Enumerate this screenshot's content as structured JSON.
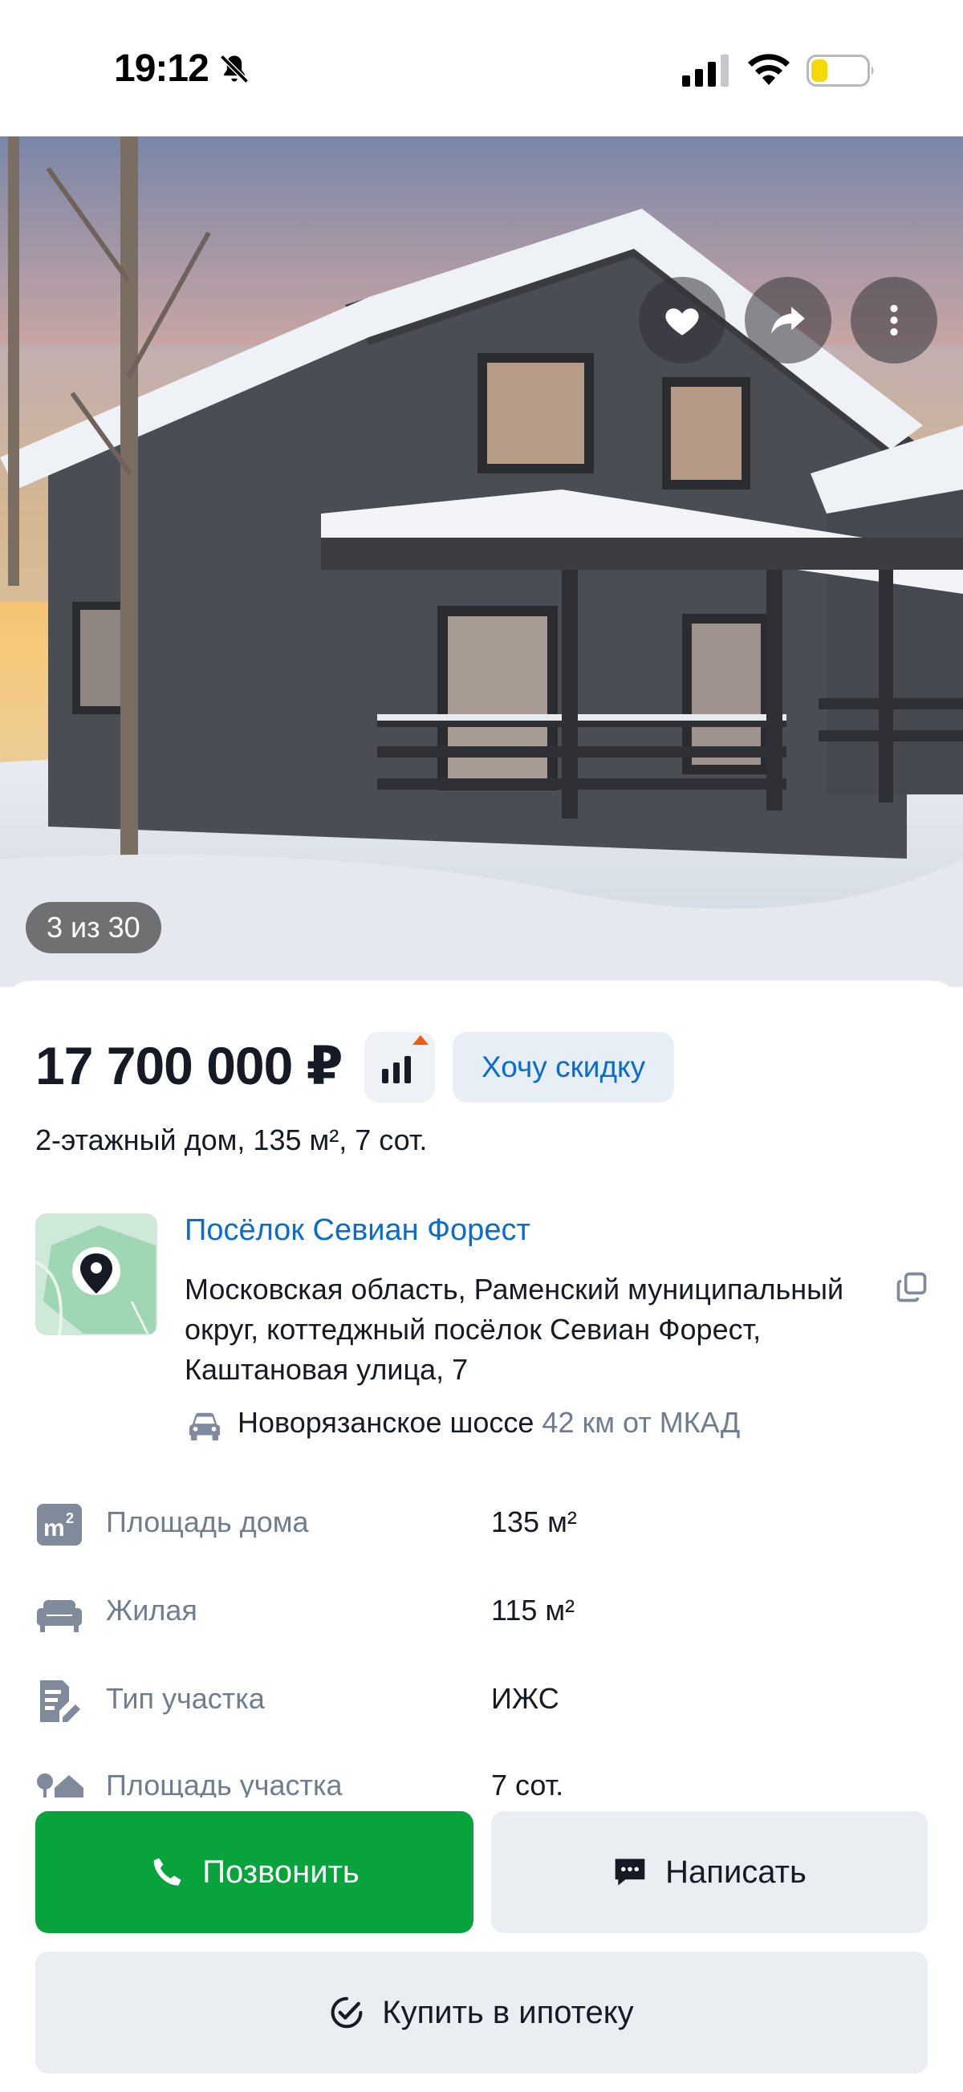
{
  "status_bar": {
    "time": "19:12"
  },
  "photo": {
    "counter": "3 из 30",
    "favorite_icon": "heart-icon",
    "share_icon": "share-arrow-icon",
    "more_icon": "more-vertical-icon"
  },
  "listing": {
    "price": "17 700 000 ₽",
    "discount_button": "Хочу скидку",
    "subtitle": "2-этажный дом, 135 м², 7 сот.",
    "village_link": "Посёлок Севиан Форест",
    "address": "Московская область, Раменский муниципальный округ, коттеджный посёлок Севиан Форест, Каштановая улица, 7",
    "highway": "Новорязанское шоссе",
    "distance": "42 км от МКАД"
  },
  "properties": [
    {
      "icon": "area-m2-icon",
      "label": "Площадь дома",
      "value": "135 м²"
    },
    {
      "icon": "sofa-icon",
      "label": "Жилая",
      "value": "115 м²"
    },
    {
      "icon": "document-pen-icon",
      "label": "Тип участка",
      "value": "ИЖС"
    },
    {
      "icon": "trees-house-icon",
      "label": "Площадь участка",
      "value": "7 сот."
    }
  ],
  "actions": {
    "call": "Позвонить",
    "write": "Написать",
    "mortgage": "Купить в ипотеку"
  },
  "colors": {
    "accent_blue": "#0a6ccf",
    "call_green": "#09a33e",
    "price_up_orange": "#f05a12",
    "muted_text": "#6f7d8f"
  }
}
